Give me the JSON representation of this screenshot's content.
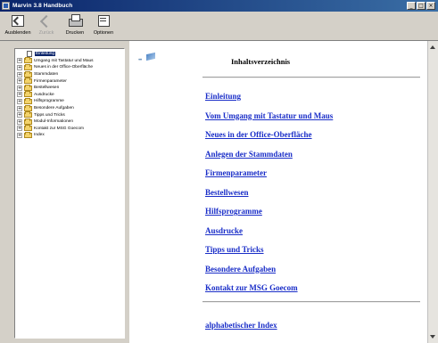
{
  "window": {
    "title": "Marvin 3.8 Handbuch",
    "buttons": {
      "minimize": "_",
      "maximize": "□",
      "close": "×"
    }
  },
  "toolbar": {
    "hide_label": "Ausblenden",
    "back_label": "Zurück",
    "print_label": "Drucken",
    "options_label": "Optionen"
  },
  "tree": {
    "items": [
      {
        "label": "Einleitung",
        "selected": true
      },
      {
        "label": "Umgang mit Tastatur und Maus"
      },
      {
        "label": "Neues in der Office-Oberfläche"
      },
      {
        "label": "Stammdaten"
      },
      {
        "label": "Firmenparameter"
      },
      {
        "label": "Bestellwesen"
      },
      {
        "label": "Ausdrucke"
      },
      {
        "label": "Hilfsprogramme"
      },
      {
        "label": "Besondere Aufgaben"
      },
      {
        "label": "Tipps und Tricks"
      },
      {
        "label": "Modul-Informationen"
      },
      {
        "label": "Kontakt zur MSG Goecom"
      },
      {
        "label": "Index"
      }
    ]
  },
  "content": {
    "logo_dots": "•••",
    "heading": "Inhaltsverzeichnis",
    "links": [
      "Einleitung",
      "Vom Umgang mit Tastatur und Maus",
      "Neues in der Office-Oberfläche",
      "Anlegen der Stammdaten",
      "Firmenparameter",
      "Bestellwesen",
      "Hilfsprogramme",
      "Ausdrucke",
      "Tipps und Tricks",
      "Besondere Aufgaben",
      "Kontakt zur MSG Goecom"
    ],
    "index_link": "alphabetischer Index"
  },
  "colors": {
    "titlebar_start": "#0a246a",
    "titlebar_end": "#3a6ea5",
    "link": "#1a2ec8",
    "selection": "#0a246a"
  }
}
